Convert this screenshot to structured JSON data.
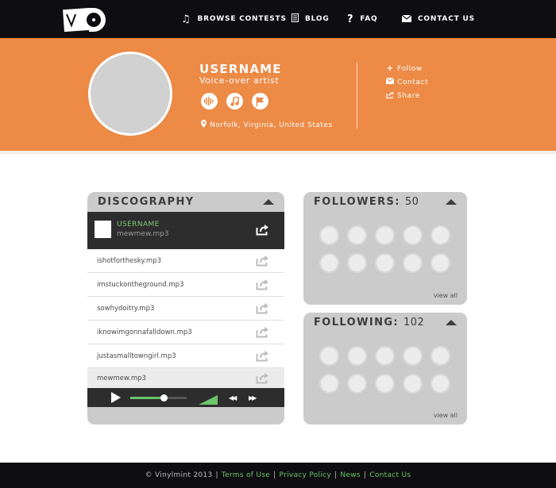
{
  "brand": {
    "logo_text": "Vinylmint"
  },
  "nav": {
    "browse": "BROWSE CONTESTS",
    "blog": "BLOG",
    "faq": "FAQ",
    "contact": "CONTACT US"
  },
  "profile": {
    "username": "USERNAME",
    "role": "Voice-over artist",
    "location": "Norfolk, Virginia, United States",
    "badges": [
      "waveform-icon",
      "music-note-icon",
      "flag-icon"
    ],
    "actions": {
      "follow": "Follow",
      "contact": "Contact",
      "share": "Share"
    }
  },
  "discography": {
    "title": "DISCOGRAPHY",
    "now_playing": {
      "user": "USERNAME",
      "file": "mewmew.mp3"
    },
    "tracks": [
      "ishotforthesky.mp3",
      "imstuckontheground.mp3",
      "sowhydoitry.mp3",
      "iknowimgonnafalldown.mp3",
      "justasmalltowngirl.mp3",
      "mewmew.mp3"
    ],
    "selected_track_index": 5,
    "playback_progress": 0.6,
    "volume_level": 1.0
  },
  "followers": {
    "label": "FOLLOWERS:",
    "count": "50",
    "view_all": "view all"
  },
  "following": {
    "label": "FOLLOWING:",
    "count": "102",
    "view_all": "view all"
  },
  "footer": {
    "copyright": "© Vinylmint 2013",
    "terms": "Terms of Use",
    "privacy": "Privacy Policy",
    "news": "News",
    "contact": "Contact Us",
    "separator": "|"
  },
  "colors": {
    "accent_orange": "#ec8a46",
    "dark": "#0e0e10",
    "panel_gray": "#cbcbcb",
    "green": "#6bc46a"
  }
}
